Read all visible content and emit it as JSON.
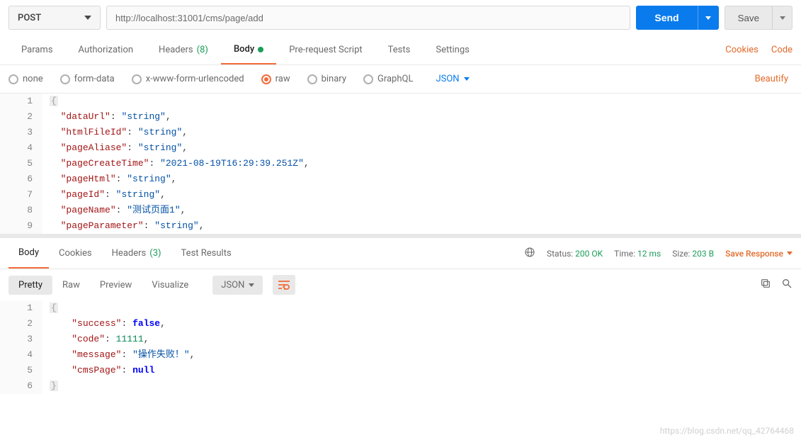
{
  "request": {
    "method": "POST",
    "url": "http://localhost:31001/cms/page/add",
    "send_label": "Send",
    "save_label": "Save"
  },
  "req_tabs": {
    "params": "Params",
    "auth": "Authorization",
    "headers": "Headers",
    "headers_count": "(8)",
    "body": "Body",
    "prerequest": "Pre-request Script",
    "tests": "Tests",
    "settings": "Settings",
    "cookies_link": "Cookies",
    "code_link": "Code"
  },
  "body_types": {
    "none": "none",
    "formdata": "form-data",
    "xwww": "x-www-form-urlencoded",
    "raw": "raw",
    "binary": "binary",
    "graphql": "GraphQL",
    "format_label": "JSON",
    "beautify": "Beautify"
  },
  "request_body": {
    "lines": [
      {
        "n": "1",
        "html": "<span class='tok-brace'>{</span>"
      },
      {
        "n": "2",
        "html": "  <span class='tok-key'>\"dataUrl\"</span><span class='tok-punc'>:</span> <span class='tok-str'>\"string\"</span><span class='tok-punc'>,</span>"
      },
      {
        "n": "3",
        "html": "  <span class='tok-key'>\"htmlFileId\"</span><span class='tok-punc'>:</span> <span class='tok-str'>\"string\"</span><span class='tok-punc'>,</span>"
      },
      {
        "n": "4",
        "html": "  <span class='tok-key'>\"pageAliase\"</span><span class='tok-punc'>:</span> <span class='tok-str'>\"string\"</span><span class='tok-punc'>,</span>"
      },
      {
        "n": "5",
        "html": "  <span class='tok-key'>\"pageCreateTime\"</span><span class='tok-punc'>:</span> <span class='tok-str'>\"2021-08-19T16:29:39.251Z\"</span><span class='tok-punc'>,</span>"
      },
      {
        "n": "6",
        "html": "  <span class='tok-key'>\"pageHtml\"</span><span class='tok-punc'>:</span> <span class='tok-str'>\"string\"</span><span class='tok-punc'>,</span>"
      },
      {
        "n": "7",
        "html": "  <span class='tok-key'>\"pageId\"</span><span class='tok-punc'>:</span> <span class='tok-str'>\"string\"</span><span class='tok-punc'>,</span>"
      },
      {
        "n": "8",
        "html": "  <span class='tok-key'>\"pageName\"</span><span class='tok-punc'>:</span> <span class='tok-str'>\"测试页面1\"</span><span class='tok-punc'>,</span>"
      },
      {
        "n": "9",
        "html": "  <span class='tok-key'>\"pageParameter\"</span><span class='tok-punc'>:</span> <span class='tok-str'>\"string\"</span><span class='tok-punc'>,</span>"
      }
    ]
  },
  "resp_tabs": {
    "body": "Body",
    "cookies": "Cookies",
    "headers": "Headers",
    "headers_count": "(3)",
    "tests": "Test Results"
  },
  "response_status": {
    "status_label": "Status:",
    "status_value": "200 OK",
    "time_label": "Time:",
    "time_value": "12 ms",
    "size_label": "Size:",
    "size_value": "203 B",
    "save_response": "Save Response"
  },
  "resp_format": {
    "pretty": "Pretty",
    "raw": "Raw",
    "preview": "Preview",
    "visualize": "Visualize",
    "json": "JSON"
  },
  "response_body": {
    "lines": [
      {
        "n": "1",
        "html": "<span class='tok-brace'>{</span>"
      },
      {
        "n": "2",
        "html": "    <span class='tok-key'>\"success\"</span><span class='tok-punc'>:</span> <span class='tok-bool'>false</span><span class='tok-punc'>,</span>"
      },
      {
        "n": "3",
        "html": "    <span class='tok-key'>\"code\"</span><span class='tok-punc'>:</span> <span class='tok-num'>11111</span><span class='tok-punc'>,</span>"
      },
      {
        "n": "4",
        "html": "    <span class='tok-key'>\"message\"</span><span class='tok-punc'>:</span> <span class='tok-str'>\"操作失败！\"</span><span class='tok-punc'>,</span>"
      },
      {
        "n": "5",
        "html": "    <span class='tok-key'>\"cmsPage\"</span><span class='tok-punc'>:</span> <span class='tok-null'>null</span>"
      },
      {
        "n": "6",
        "html": "<span class='tok-brace'>}</span>"
      }
    ]
  },
  "watermark": "https://blog.csdn.net/qq_42764468"
}
